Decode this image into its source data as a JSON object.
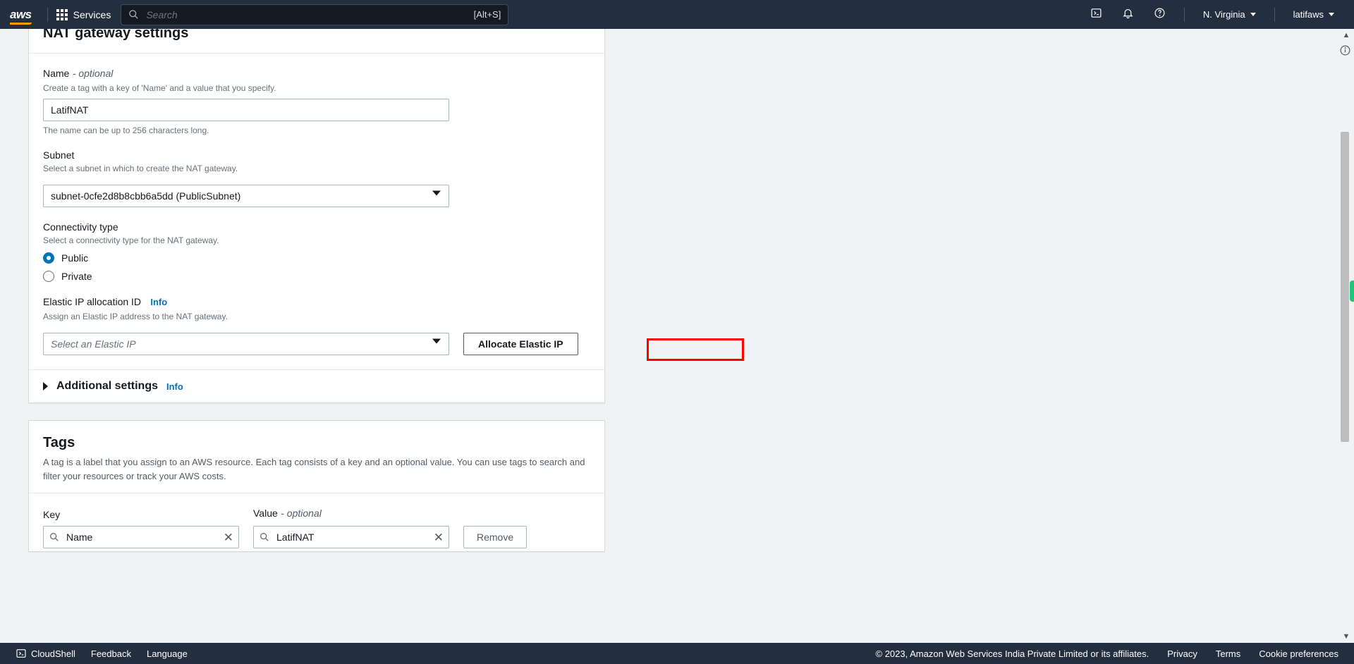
{
  "topnav": {
    "logo": "aws",
    "services": "Services",
    "search_placeholder": "Search",
    "search_hint": "[Alt+S]",
    "region": "N. Virginia",
    "account": "latifaws"
  },
  "nat_settings": {
    "heading": "NAT gateway settings",
    "name": {
      "label": "Name",
      "optional": "- optional",
      "desc": "Create a tag with a key of 'Name' and a value that you specify.",
      "value": "LatifNAT",
      "hint": "The name can be up to 256 characters long."
    },
    "subnet": {
      "label": "Subnet",
      "desc": "Select a subnet in which to create the NAT gateway.",
      "value": "subnet-0cfe2d8b8cbb6a5dd (PublicSubnet)"
    },
    "connectivity": {
      "label": "Connectivity type",
      "desc": "Select a connectivity type for the NAT gateway.",
      "options": {
        "public": "Public",
        "private": "Private"
      },
      "selected": "public"
    },
    "eip": {
      "label": "Elastic IP allocation ID",
      "info": "Info",
      "desc": "Assign an Elastic IP address to the NAT gateway.",
      "placeholder": "Select an Elastic IP",
      "allocate_btn": "Allocate Elastic IP"
    },
    "additional": {
      "label": "Additional settings",
      "info": "Info"
    }
  },
  "tags": {
    "heading": "Tags",
    "desc": "A tag is a label that you assign to an AWS resource. Each tag consists of a key and an optional value. You can use tags to search and filter your resources or track your AWS costs.",
    "key_label": "Key",
    "value_label": "Value",
    "value_optional": "- optional",
    "row": {
      "key": "Name",
      "value": "LatifNAT"
    },
    "remove_btn": "Remove"
  },
  "footer": {
    "cloudshell": "CloudShell",
    "feedback": "Feedback",
    "language": "Language",
    "copyright": "© 2023, Amazon Web Services India Private Limited or its affiliates.",
    "privacy": "Privacy",
    "terms": "Terms",
    "cookies": "Cookie preferences"
  }
}
